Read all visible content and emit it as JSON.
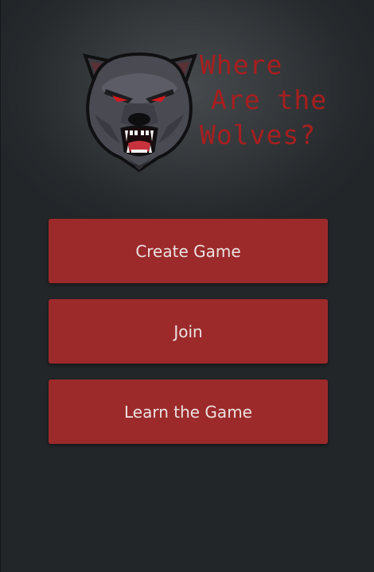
{
  "logo": {
    "title_lines": [
      "Where",
      "Are the",
      "Wolves?"
    ],
    "icon": "wolf-head-icon"
  },
  "menu": {
    "create_label": "Create Game",
    "join_label": "Join",
    "learn_label": "Learn the Game"
  },
  "colors": {
    "background": "#2b2f32",
    "button": "#9c2a2a",
    "button_text": "#ece2e2",
    "title_text": "#a81e1e"
  }
}
